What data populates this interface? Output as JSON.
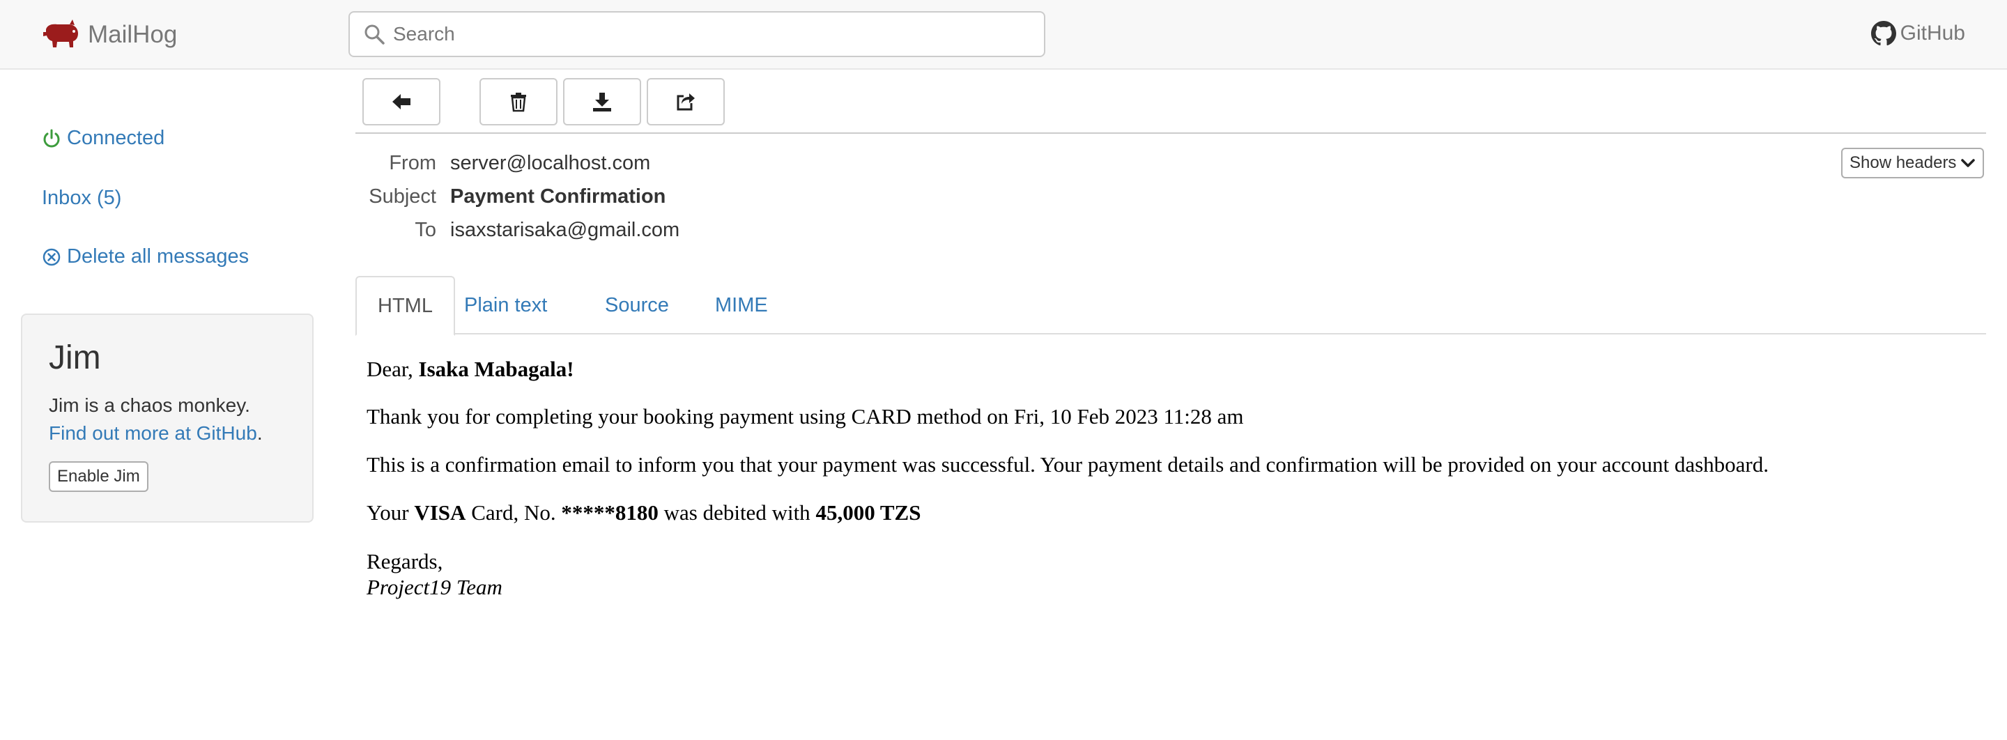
{
  "navbar": {
    "brand": "MailHog",
    "search_placeholder": "Search",
    "github_label": "GitHub"
  },
  "sidebar": {
    "connected_label": "Connected",
    "inbox_label": "Inbox (5)",
    "delete_all_label": "Delete all messages",
    "jim": {
      "title": "Jim",
      "description": "Jim is a chaos monkey.",
      "link_text": "Find out more at GitHub",
      "link_suffix": ".",
      "button_label": "Enable Jim"
    }
  },
  "toolbar": {
    "buttons": [
      {
        "icon": "arrow-left-icon"
      },
      {
        "icon": "trash-icon"
      },
      {
        "icon": "download-icon"
      },
      {
        "icon": "share-icon"
      }
    ]
  },
  "message": {
    "from_label": "From",
    "from_value": "server@localhost.com",
    "subject_label": "Subject",
    "subject_value": "Payment Confirmation",
    "to_label": "To",
    "to_value": "isaxstarisaka@gmail.com",
    "show_headers_label": "Show headers"
  },
  "tabs": {
    "html": "HTML",
    "plain": "Plain text",
    "source": "Source",
    "mime": "MIME",
    "active": "HTML"
  },
  "email_body": {
    "greeting_prefix": "Dear, ",
    "greeting_name": "Isaka Mabagala!",
    "line1": "Thank you for completing your booking payment using CARD method on Fri, 10 Feb 2023 11:28 am",
    "line2": "This is a confirmation email to inform you that your payment was successful. Your payment details and confirmation will be provided on your account dashboard.",
    "line3_a": "Your ",
    "line3_card": "VISA",
    "line3_b": " Card, No. ",
    "line3_number": "*****8180",
    "line3_c": " was debited with ",
    "line3_amount": "45,000 TZS",
    "regards": "Regards,",
    "signature": "Project19 Team"
  },
  "colors": {
    "link": "#337ab7",
    "connected": "#3c9c3c",
    "logo": "#9b1c1c"
  }
}
